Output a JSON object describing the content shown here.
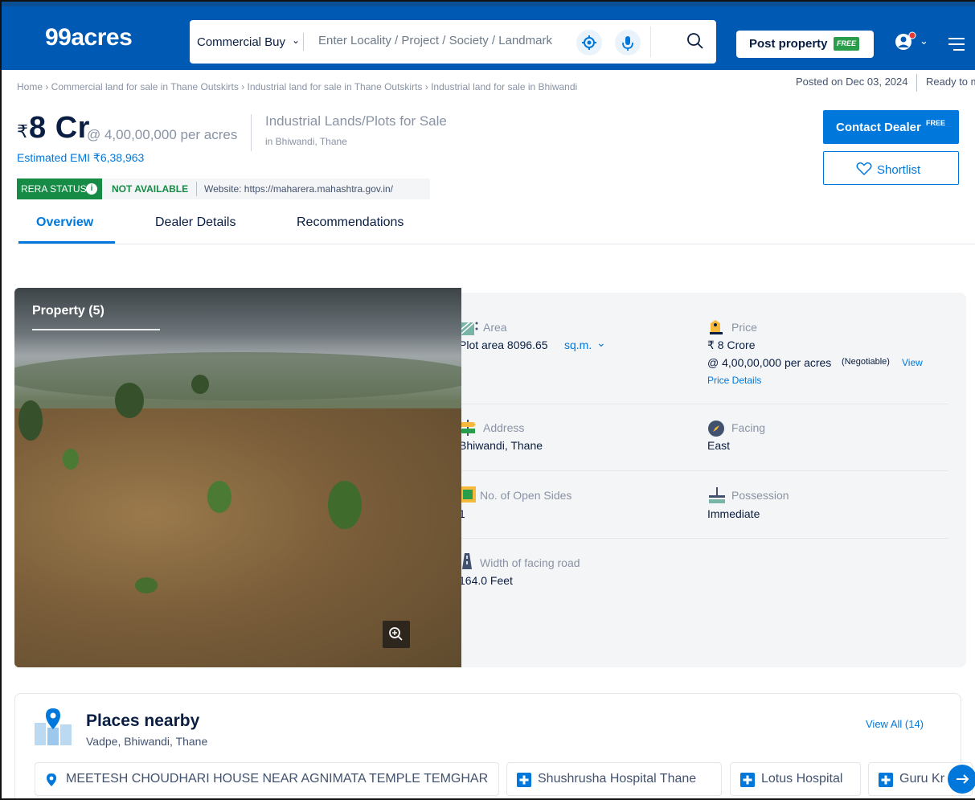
{
  "header": {
    "logo": "99acres",
    "search_type": "Commercial Buy",
    "search_placeholder": "Enter Locality / Project / Society / Landmark",
    "post_property": "Post property",
    "free_badge": "FREE"
  },
  "breadcrumb": {
    "text": "Home › Commercial land for sale in Thane Outskirts › Industrial land for sale in Thane Outskirts › Industrial land for sale in Bhiwandi",
    "posted": "Posted on Dec 03, 2024",
    "ready": "Ready to m"
  },
  "price": {
    "rupee": "₹",
    "amount": "8 Cr",
    "rate": "@ 4,00,00,000 per acres",
    "emi": "Estimated EMI ₹6,38,963",
    "title": "Industrial Lands/Plots for Sale",
    "location": "in Bhiwandi, Thane"
  },
  "actions": {
    "contact": "Contact Dealer",
    "contact_free": "FREE",
    "shortlist": "Shortlist"
  },
  "rera": {
    "status_label": "RERA STATUS",
    "status_value": "NOT AVAILABLE",
    "website": "Website: https://maharera.mahashtra.gov.in/"
  },
  "tabs": [
    {
      "label": "Overview"
    },
    {
      "label": "Dealer Details"
    },
    {
      "label": "Recommendations"
    }
  ],
  "photo": {
    "title": "Property (5)"
  },
  "details": {
    "area_label": "Area",
    "area_value": "Plot area 8096.65",
    "area_unit": "sq.m.",
    "price_label": "Price",
    "price_value": "₹ 8 Crore",
    "price_rate": "@ 4,00,00,000 per acres",
    "price_negotiable": "(Negotiable)",
    "price_link_1": "View",
    "price_link_2": "Price Details",
    "address_label": "Address",
    "address_value": "Bhiwandi, Thane",
    "facing_label": "Facing",
    "facing_value": "East",
    "open_sides_label": "No. of Open Sides",
    "open_sides_value": "1",
    "possession_label": "Possession",
    "possession_value": "Immediate",
    "road_label": "Width of facing road",
    "road_value": "164.0 Feet"
  },
  "places": {
    "title": "Places nearby",
    "subtitle": "Vadpe, Bhiwandi, Thane",
    "view_all": "View All (14)",
    "chips": [
      {
        "label": "MEETESH CHOUDHARI HOUSE NEAR AGNIMATA TEMPLE TEMGHAR",
        "icon": "location-pin-icon"
      },
      {
        "label": "Shushrusha Hospital Thane",
        "icon": "hospital-icon"
      },
      {
        "label": "Lotus Hospital",
        "icon": "hospital-icon"
      },
      {
        "label": "Guru Kr",
        "icon": "hospital-icon"
      }
    ]
  },
  "colors": {
    "brand": "#0059B3",
    "accent": "#0078DB",
    "rera_green": "#158B45"
  }
}
